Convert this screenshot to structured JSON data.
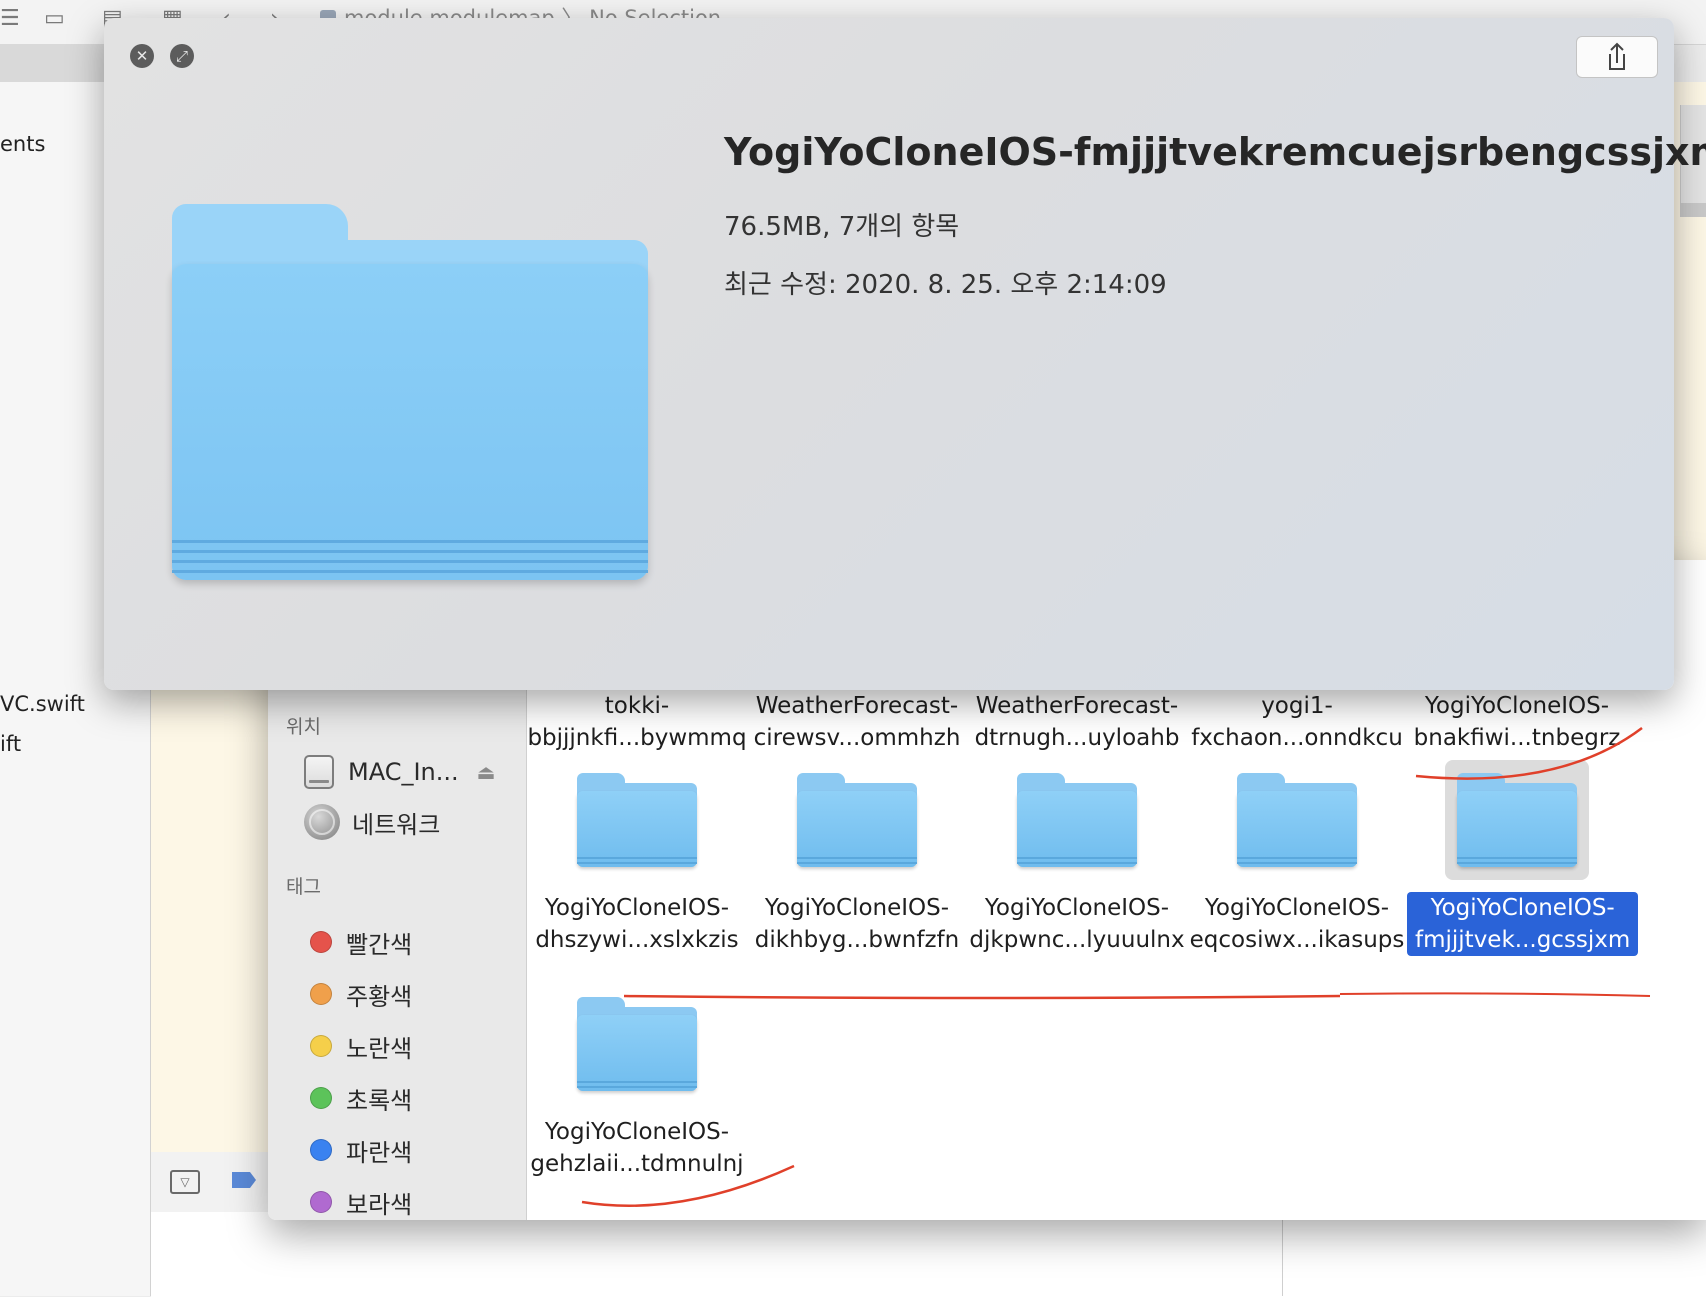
{
  "xcode": {
    "jump_file": "module.modulemap",
    "jump_separator": "〉",
    "jump_selection": "No Selection",
    "left_items": [
      "ents",
      "VC.swift",
      "ift"
    ]
  },
  "quicklook": {
    "title": "YogiYoCloneIOS-fmjjjtvekremcuejsrbengcssjxm",
    "size_info": "76.5MB, 7개의 항목",
    "modified": "최근 수정: 2020. 8. 25. 오후 2:14:09"
  },
  "finder": {
    "sidebar": {
      "locations_header": "위치",
      "disk_label": "MAC_In...",
      "network_label": "네트워크",
      "tags_header": "태그",
      "tags": [
        {
          "label": "빨간색",
          "color": "#e5534b"
        },
        {
          "label": "주황색",
          "color": "#f0a04b"
        },
        {
          "label": "노란색",
          "color": "#f5cf4a"
        },
        {
          "label": "초록색",
          "color": "#5cc35a"
        },
        {
          "label": "파란색",
          "color": "#3a82f0"
        },
        {
          "label": "보라색",
          "color": "#b06ad0"
        }
      ]
    },
    "top_row_labels": [
      {
        "line1": "tokki-",
        "line2": "bbjjjnkfi...bywmmq"
      },
      {
        "line1": "WeatherForecast-",
        "line2": "cirewsv...ommhzh"
      },
      {
        "line1": "WeatherForecast-",
        "line2": "dtrnugh...uyloahb"
      },
      {
        "line1": "yogi1-",
        "line2": "fxchaon...onndkcu"
      },
      {
        "line1": "YogiYoCloneIOS-",
        "line2": "bnakfiwi...tnbegrz"
      }
    ],
    "folders": [
      {
        "line1": "YogiYoCloneIOS-",
        "line2": "dhszywi...xslxkzis"
      },
      {
        "line1": "YogiYoCloneIOS-",
        "line2": "dikhbyg...bwnfzfn"
      },
      {
        "line1": "YogiYoCloneIOS-",
        "line2": "djkpwnc...lyuuulnx"
      },
      {
        "line1": "YogiYoCloneIOS-",
        "line2": "eqcosiwx...ikasups"
      },
      {
        "line1": "YogiYoCloneIOS-",
        "line2": "fmjjjtvek...gcssjxm"
      },
      {
        "line1": "YogiYoCloneIOS-",
        "line2": "gehzlaii...tdmnulnj"
      }
    ],
    "selected_index": 4
  },
  "annotation_color": "#e0402a"
}
